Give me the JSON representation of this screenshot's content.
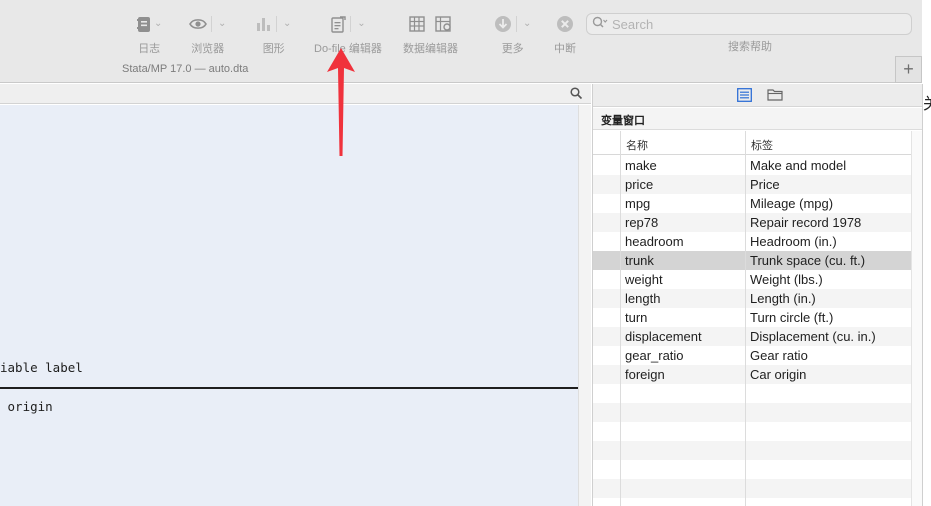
{
  "toolbar": {
    "buttons": [
      {
        "label": "日志",
        "icon": "log-notebook-icon"
      },
      {
        "label": "浏览器",
        "icon": "eye-icon"
      },
      {
        "label": "图形",
        "icon": "bar-graph-icon"
      },
      {
        "label": "Do-file 编辑器",
        "icon": "do-file-editor-icon"
      },
      {
        "label": "数据编辑器",
        "icon": "data-editor-icon"
      },
      {
        "label": "更多",
        "icon": "more-down-arrow-icon"
      },
      {
        "label": "中断",
        "icon": "break-icon"
      }
    ],
    "search_placeholder": "Search",
    "search_help": "搜索帮助"
  },
  "window": {
    "title": "Stata/MP 17.0 — auto.dta",
    "new_tab": "+"
  },
  "results": {
    "line_header": "iable label",
    "line_value": " origin"
  },
  "variables": {
    "title": "变量窗口",
    "col_name": "名称",
    "col_label": "标签",
    "rows": [
      {
        "name": "make",
        "label": "Make and model"
      },
      {
        "name": "price",
        "label": "Price"
      },
      {
        "name": "mpg",
        "label": "Mileage (mpg)"
      },
      {
        "name": "rep78",
        "label": "Repair record 1978"
      },
      {
        "name": "headroom",
        "label": "Headroom (in.)"
      },
      {
        "name": "trunk",
        "label": "Trunk space (cu. ft.)",
        "selected": true
      },
      {
        "name": "weight",
        "label": "Weight (lbs.)"
      },
      {
        "name": "length",
        "label": "Length (in.)"
      },
      {
        "name": "turn",
        "label": "Turn circle (ft.)"
      },
      {
        "name": "displacement",
        "label": "Displacement (cu. in.)"
      },
      {
        "name": "gear_ratio",
        "label": "Gear ratio"
      },
      {
        "name": "foreign",
        "label": "Car origin"
      }
    ]
  },
  "edge_glyph": "关",
  "colors": {
    "toolbar_bg": "#e8e8e8",
    "results_bg": "#e9eef7",
    "selected_row": "#d4d4d4",
    "annotation_arrow": "#f0323c"
  }
}
